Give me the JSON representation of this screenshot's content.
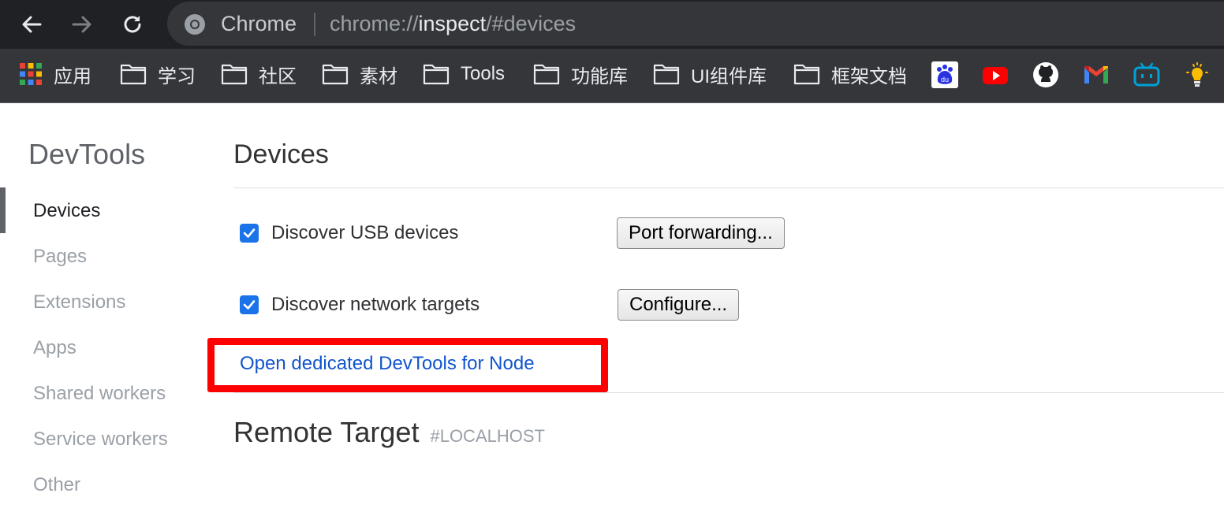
{
  "browser": {
    "omnibox": {
      "label": "Chrome",
      "url_scheme": "chrome://",
      "url_host": "inspect",
      "url_path": "/#devices"
    },
    "bookmarks": [
      {
        "label": "应用",
        "icon": "apps-grid-icon"
      },
      {
        "label": "学习",
        "icon": "folder-icon"
      },
      {
        "label": "社区",
        "icon": "folder-icon"
      },
      {
        "label": "素材",
        "icon": "folder-icon"
      },
      {
        "label": "Tools",
        "icon": "folder-icon"
      },
      {
        "label": "功能库",
        "icon": "folder-icon"
      },
      {
        "label": "UI组件库",
        "icon": "folder-icon"
      },
      {
        "label": "框架文档",
        "icon": "folder-icon"
      }
    ],
    "bookmark_icons": [
      "baidu-icon",
      "youtube-icon",
      "github-icon",
      "gmail-icon",
      "bilibili-icon",
      "lightbulb-icon"
    ]
  },
  "sidebar": {
    "title": "DevTools",
    "items": [
      {
        "label": "Devices",
        "active": true
      },
      {
        "label": "Pages",
        "active": false
      },
      {
        "label": "Extensions",
        "active": false
      },
      {
        "label": "Apps",
        "active": false
      },
      {
        "label": "Shared workers",
        "active": false
      },
      {
        "label": "Service workers",
        "active": false
      },
      {
        "label": "Other",
        "active": false
      }
    ]
  },
  "main": {
    "title": "Devices",
    "discover_usb": {
      "label": "Discover USB devices",
      "checked": true
    },
    "port_forwarding_button": "Port forwarding...",
    "discover_network": {
      "label": "Discover network targets",
      "checked": true
    },
    "configure_button": "Configure...",
    "node_link": "Open dedicated DevTools for Node",
    "remote_title": "Remote Target",
    "remote_tag": "#LOCALHOST"
  },
  "colors": {
    "checkbox": "#1a73e8",
    "link": "#1155cc",
    "highlight": "#ff0000"
  }
}
